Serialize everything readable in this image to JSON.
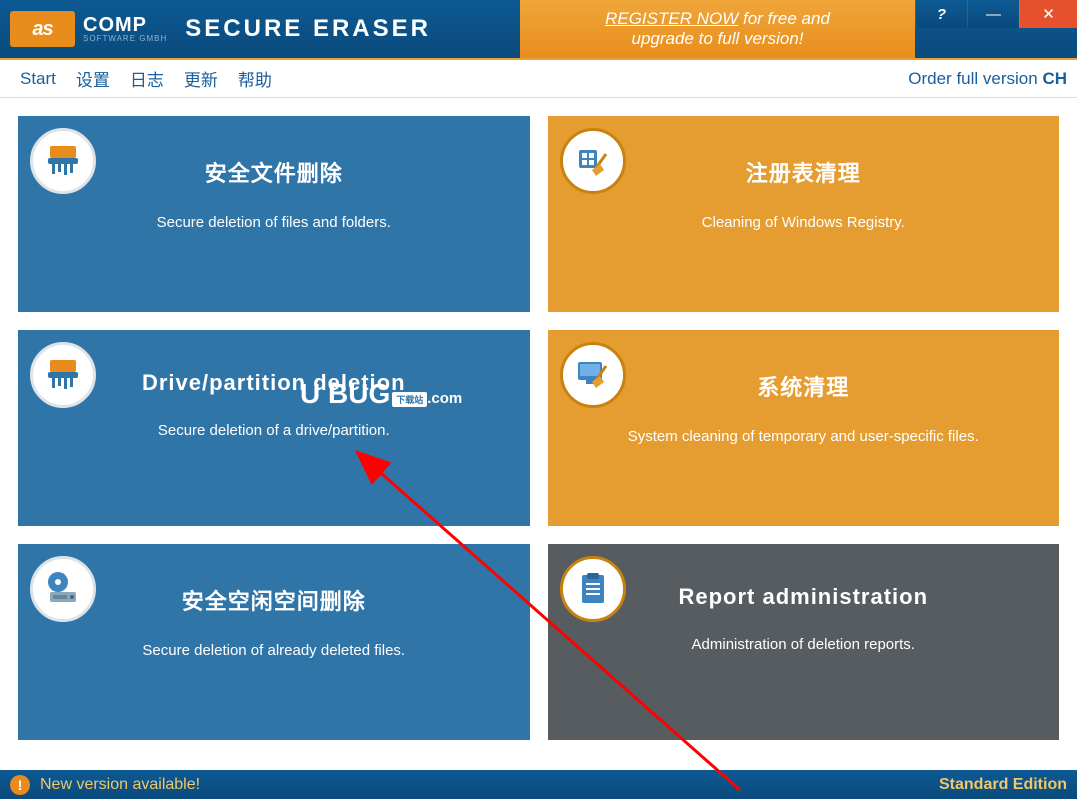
{
  "titlebar": {
    "logo_badge": "as",
    "logo_text": "COMP",
    "logo_sub": "SOFTWARE GMBH",
    "app_title": "SECURE ERASER",
    "register_line1_underline": "REGISTER NOW",
    "register_line1_rest": " for free and",
    "register_line2": "upgrade to full version!",
    "help_btn": "?",
    "min_btn": "—",
    "close_btn": "✕"
  },
  "menubar": {
    "items": [
      "Start",
      "设置",
      "日志",
      "更新",
      "帮助"
    ],
    "order_link": "Order full version ",
    "order_ch": "CH"
  },
  "tiles": [
    {
      "title": "安全文件删除",
      "desc": "Secure deletion of files and folders.",
      "icon": "shredder-icon",
      "color": "blue"
    },
    {
      "title": "注册表清理",
      "desc": "Cleaning of Windows Registry.",
      "icon": "registry-broom-icon",
      "color": "orange"
    },
    {
      "title": "Drive/partition deletion",
      "desc": "Secure deletion of a drive/partition.",
      "icon": "drive-shredder-icon",
      "color": "blue"
    },
    {
      "title": "系统清理",
      "desc": "System cleaning of temporary and user-specific files.",
      "icon": "monitor-broom-icon",
      "color": "orange"
    },
    {
      "title": "安全空闲空间删除",
      "desc": "Secure deletion of already deleted files.",
      "icon": "disc-drive-icon",
      "color": "blue"
    },
    {
      "title": "Report administration",
      "desc": "Administration of deletion reports.",
      "icon": "clipboard-icon",
      "color": "gray"
    }
  ],
  "watermark": {
    "brand": "U BUG",
    "dom": ".com",
    "badge": "下载站"
  },
  "statusbar": {
    "alert": "!",
    "text": "New version available!",
    "edition": "Standard Edition"
  }
}
